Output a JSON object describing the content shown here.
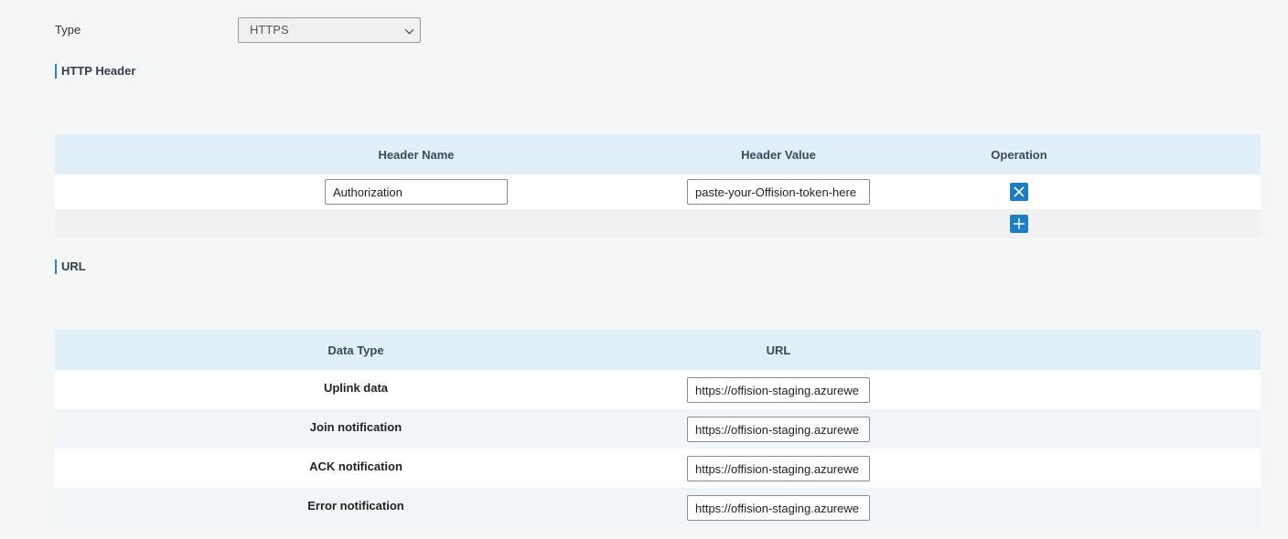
{
  "type_field": {
    "label": "Type",
    "selected": "HTTPS"
  },
  "http_header": {
    "title": "HTTP Header",
    "columns": [
      "Header Name",
      "Header Value",
      "Operation"
    ],
    "rows": [
      {
        "name": "Authorization",
        "value": "paste-your-Offision-token-here"
      }
    ],
    "delete_icon": "close-icon",
    "add_icon": "plus-icon"
  },
  "url_section": {
    "title": "URL",
    "columns": [
      "Data Type",
      "URL"
    ],
    "rows": [
      {
        "type": "Uplink data",
        "url": "https://offision-staging.azurewe"
      },
      {
        "type": "Join notification",
        "url": "https://offision-staging.azurewe"
      },
      {
        "type": "ACK notification",
        "url": "https://offision-staging.azurewe"
      },
      {
        "type": "Error notification",
        "url": "https://offision-staging.azurewe"
      }
    ]
  },
  "colors": {
    "accent": "#1f7dc3",
    "table_header": "#e1eff8",
    "page_background": "#f5f7f7"
  }
}
